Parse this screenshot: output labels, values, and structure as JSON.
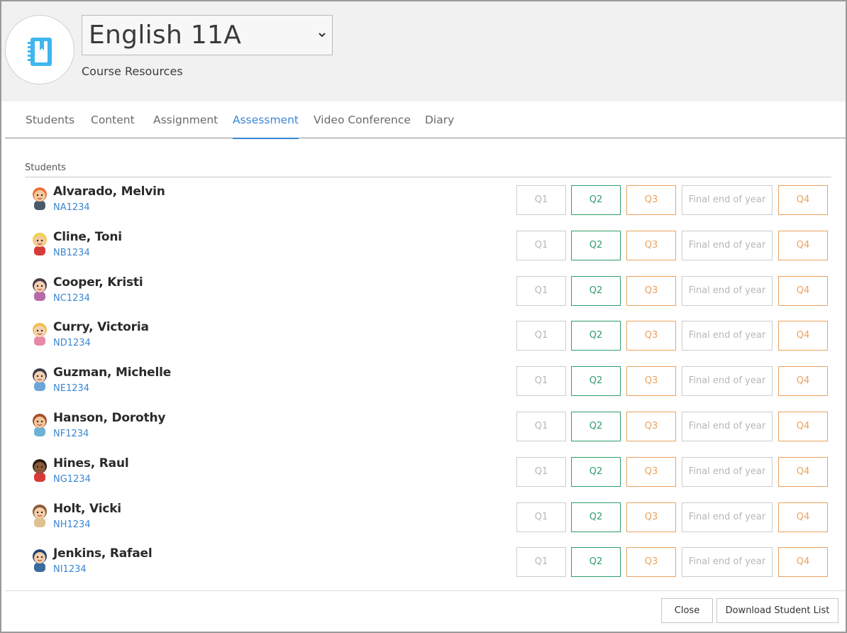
{
  "header": {
    "course_title": "English 11A",
    "course_subtitle": "Course Resources",
    "logo_icon": "notebook-icon",
    "accent_color": "#3fb6ef"
  },
  "tabs": [
    {
      "label": "Students",
      "active": false
    },
    {
      "label": "Content",
      "active": false
    },
    {
      "label": "Assignment",
      "active": false
    },
    {
      "label": "Assessment",
      "active": true
    },
    {
      "label": "Video Conference",
      "active": false
    },
    {
      "label": "Diary",
      "active": false
    }
  ],
  "students_section": {
    "label": "Students",
    "assessment_buttons": [
      "Q1",
      "Q2",
      "Q3",
      "Final end of year",
      "Q4"
    ],
    "rows": [
      {
        "name": "Alvarado, Melvin",
        "id": "NA1234",
        "avatar": "boy-redhead-avatar"
      },
      {
        "name": "Cline, Toni",
        "id": "NB1234",
        "avatar": "boy-blond-avatar"
      },
      {
        "name": "Cooper, Kristi",
        "id": "NC1234",
        "avatar": "girl-pigtails-avatar"
      },
      {
        "name": "Curry, Victoria",
        "id": "ND1234",
        "avatar": "girl-blonde-avatar"
      },
      {
        "name": "Guzman, Michelle",
        "id": "NE1234",
        "avatar": "girl-dark-hair-avatar"
      },
      {
        "name": "Hanson, Dorothy",
        "id": "NF1234",
        "avatar": "girl-brown-hair-avatar"
      },
      {
        "name": "Hines, Raul",
        "id": "NG1234",
        "avatar": "boy-dark-avatar"
      },
      {
        "name": "Holt, Vicki",
        "id": "NH1234",
        "avatar": "girl-short-hair-avatar"
      },
      {
        "name": "Jenkins, Rafael",
        "id": "NI1234",
        "avatar": "boy-blue-hair-avatar"
      }
    ]
  },
  "footer": {
    "close_label": "Close",
    "download_label": "Download Student List"
  },
  "colors": {
    "link_blue": "#3a86d4",
    "q2_green": "#2e9e6a",
    "q3_q4_orange": "#e9a25f",
    "inactive_grey": "#b7b7b7"
  }
}
